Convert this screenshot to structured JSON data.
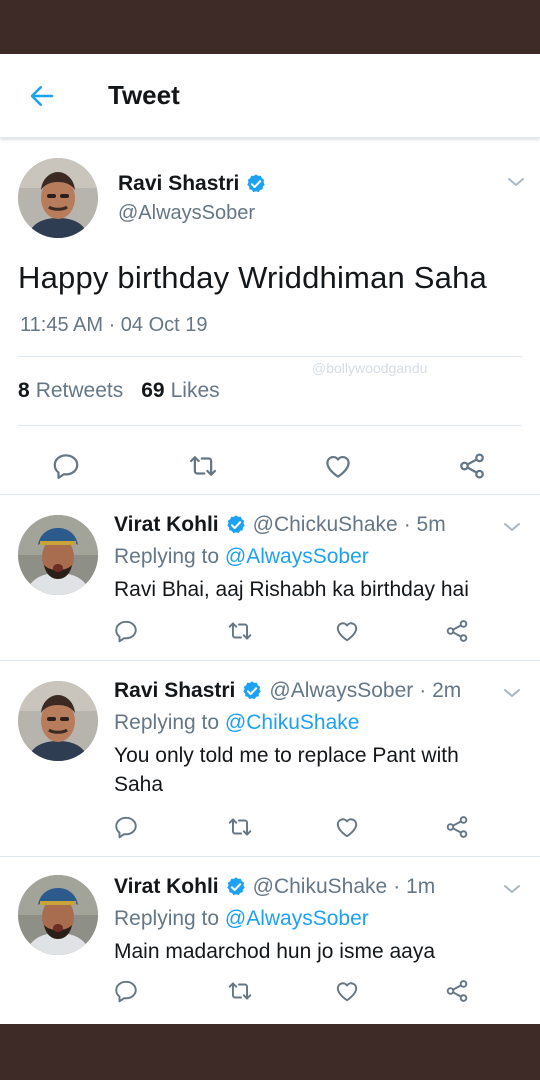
{
  "header": {
    "title": "Tweet"
  },
  "main_tweet": {
    "name": "Ravi Shastri",
    "handle": "@AlwaysSober",
    "text": "Happy birthday Wriddhiman Saha",
    "timestamp": "11:45 AM · 04 Oct 19",
    "watermark": "@bollywoodgandu",
    "retweets_count": "8",
    "retweets_label": "Retweets",
    "likes_count": "69",
    "likes_label": "Likes"
  },
  "replies": [
    {
      "name": "Virat Kohli",
      "handle": "@ChickuShake",
      "time": "· 5m",
      "replying_prefix": "Replying to ",
      "replying_to": "@AlwaysSober",
      "text": "Ravi Bhai, aaj Rishabh ka birthday hai"
    },
    {
      "name": "Ravi Shastri",
      "handle": "@AlwaysSober",
      "time": "· 2m",
      "replying_prefix": "Replying to ",
      "replying_to": "@ChikuShake",
      "text": "You only told me to replace Pant with Saha"
    },
    {
      "name": "Virat Kohli",
      "handle": "@ChikuShake",
      "time": "· 1m",
      "replying_prefix": "Replying to ",
      "replying_to": "@AlwaysSober",
      "text": "Main madarchod hun jo isme aaya"
    }
  ],
  "icons": {
    "back": "arrow-left-icon",
    "verified": "verified-badge-icon",
    "caret": "chevron-down-icon",
    "reply": "reply-icon",
    "retweet": "retweet-icon",
    "like": "heart-icon",
    "share": "share-icon"
  },
  "colors": {
    "accent": "#1da1f2",
    "text": "#14171a",
    "secondary": "#657786",
    "frame": "#3e2b27"
  }
}
